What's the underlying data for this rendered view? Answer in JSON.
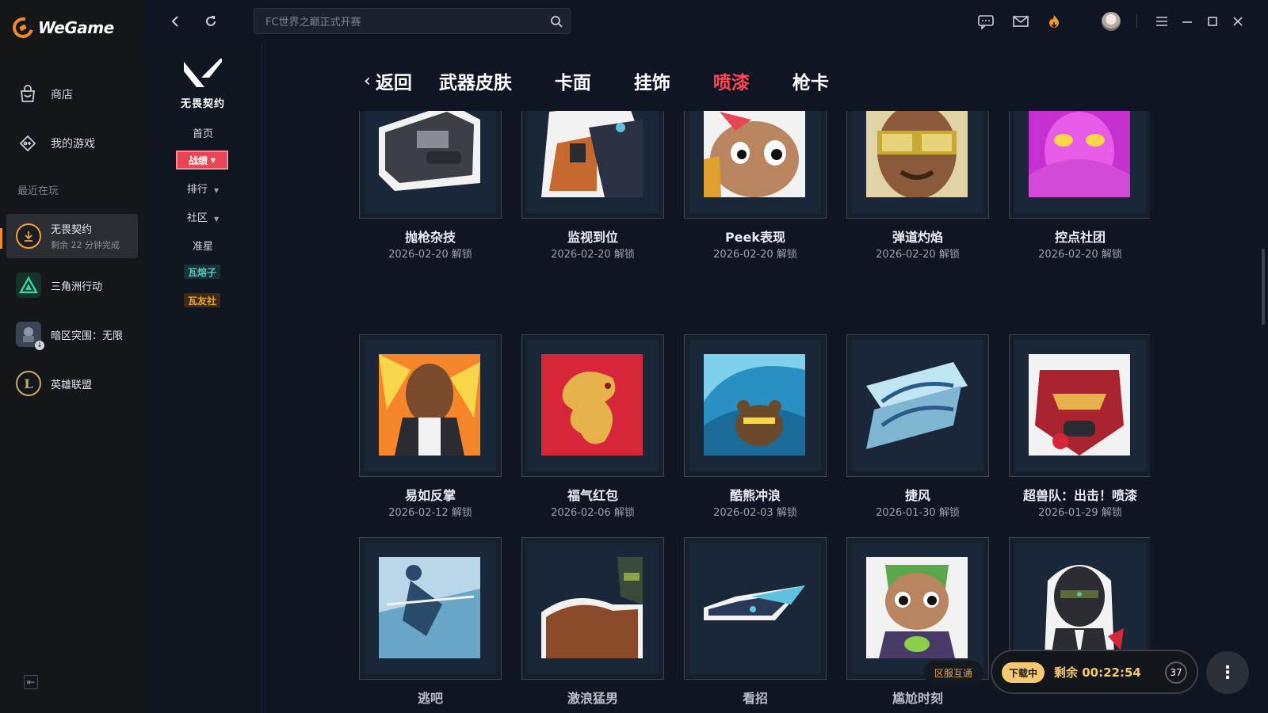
{
  "app": {
    "logo_text": "WeGame",
    "nav": [
      {
        "label": "商店",
        "icon": "store-bag-icon"
      },
      {
        "label": "我的游戏",
        "icon": "gamepad-icon"
      }
    ],
    "recent_title": "最近在玩",
    "recent": [
      {
        "name": "无畏契约",
        "sub": "剩余 22 分钟完成",
        "icon": "valorant-download-icon",
        "active": true
      },
      {
        "name": "三角洲行动",
        "icon": "delta-force-icon"
      },
      {
        "name": "暗区突围：无限",
        "icon": "arena-breakout-icon"
      },
      {
        "name": "英雄联盟",
        "icon": "lol-icon"
      }
    ]
  },
  "topbar": {
    "search_placeholder": "FC世界之巅正式开赛",
    "icons": [
      "back-icon",
      "refresh-icon",
      "search-icon",
      "chat-icon",
      "mail-icon",
      "fire-icon",
      "avatar",
      "menu-icon",
      "minimize-icon",
      "maximize-icon",
      "close-icon"
    ]
  },
  "game_nav": {
    "logo_title": "无畏契约",
    "items": {
      "home": "首页",
      "record": "战绩",
      "rank": "排行",
      "community": "社区",
      "crosshair": "准星"
    },
    "badges": [
      {
        "label": "瓦熔子",
        "color": "#55c6b4"
      },
      {
        "label": "瓦友社",
        "color": "#e8a43c"
      }
    ]
  },
  "content": {
    "back_label": "返回",
    "tabs": [
      {
        "label": "武器皮肤",
        "active": false
      },
      {
        "label": "卡面",
        "active": false
      },
      {
        "label": "挂饰",
        "active": false
      },
      {
        "label": "喷漆",
        "active": true
      },
      {
        "label": "枪卡",
        "active": false
      }
    ],
    "unlock_suffix": "解锁",
    "sprays": [
      {
        "name": "抛枪杂技",
        "date": "2026-02-20 解锁"
      },
      {
        "name": "监视到位",
        "date": "2026-02-20 解锁"
      },
      {
        "name": "Peek表现",
        "date": "2026-02-20 解锁"
      },
      {
        "name": "弹道灼焰",
        "date": "2026-02-20 解锁"
      },
      {
        "name": "控点社团",
        "date": "2026-02-20 解锁"
      },
      {
        "name": "易如反掌",
        "date": "2026-02-12 解锁"
      },
      {
        "name": "福气红包",
        "date": "2026-02-06 解锁"
      },
      {
        "name": "酷熊冲浪",
        "date": "2026-02-03 解锁"
      },
      {
        "name": "捷风",
        "date": "2026-01-30 解锁"
      },
      {
        "name": "超兽队：出击！喷漆",
        "date": "2026-01-29 解锁"
      },
      {
        "name": "逃吧",
        "date": ""
      },
      {
        "name": "激浪猛男",
        "date": ""
      },
      {
        "name": "看招",
        "date": ""
      },
      {
        "name": "尴尬时刻",
        "date": ""
      },
      {
        "name": "",
        "date": ""
      }
    ]
  },
  "download": {
    "region_label": "区服互通",
    "status": "下载中",
    "remaining": "剩余 00:22:54",
    "queue_count": "37"
  }
}
